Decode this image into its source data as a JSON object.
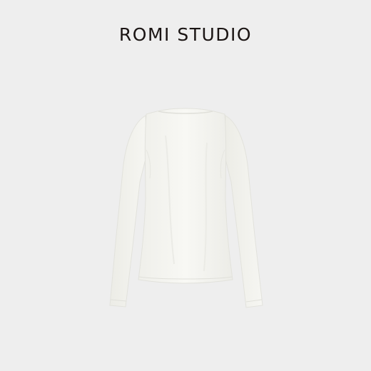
{
  "brand": {
    "name": "ROMI STUDIO"
  },
  "product": {
    "icon": "long-sleeve-tshirt-back-view",
    "garment_color": "#f7f7f3",
    "shadow_color": "#dcdcd6"
  },
  "colors": {
    "background": "#eeeeee",
    "brand_text": "#1a1413"
  }
}
